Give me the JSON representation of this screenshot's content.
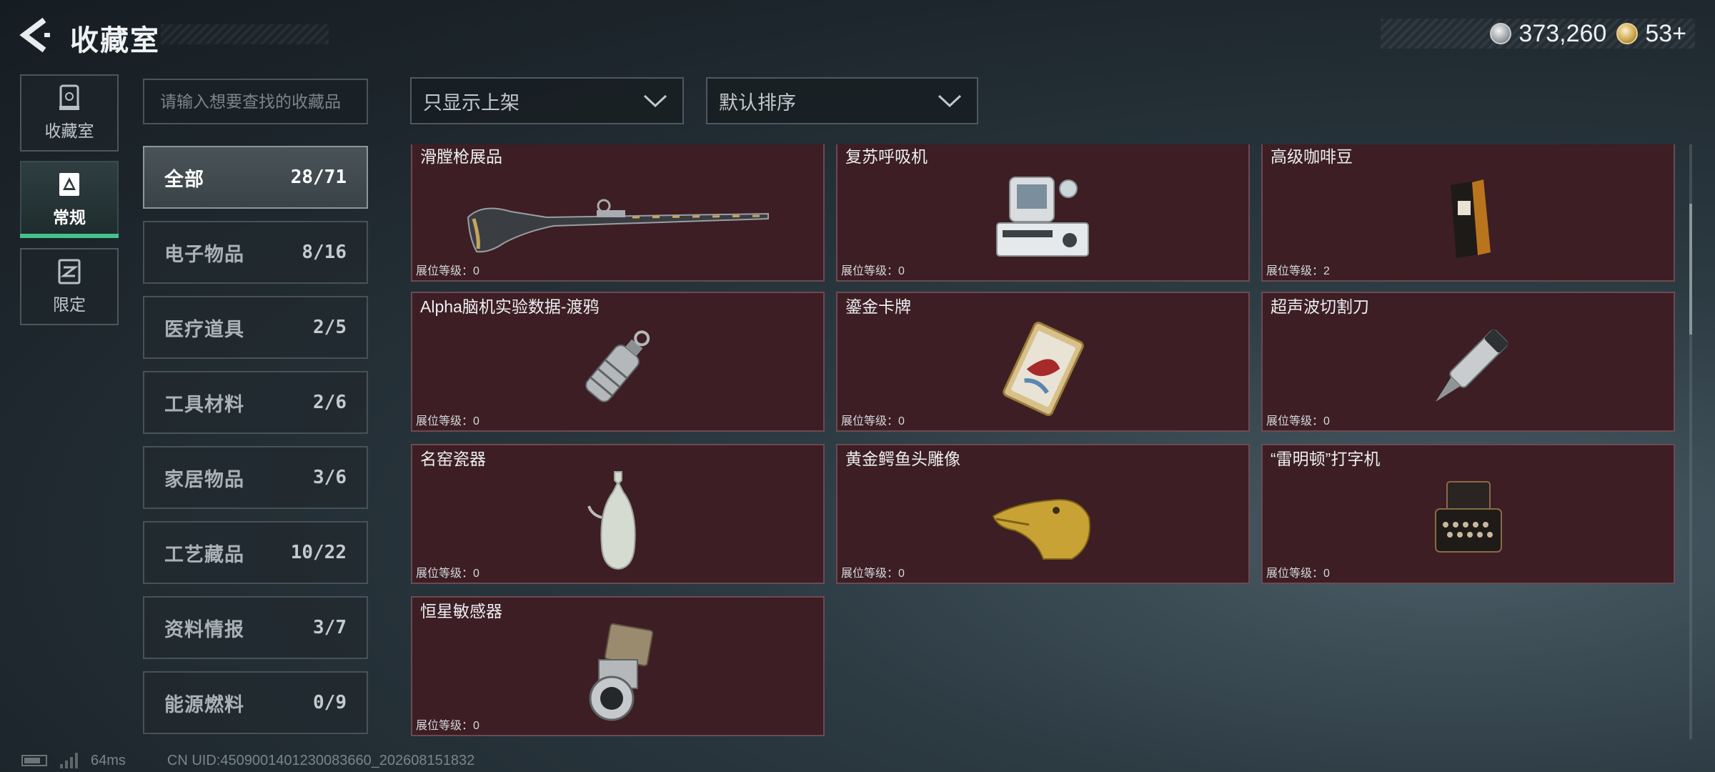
{
  "header": {
    "title": "收藏室",
    "currencies": [
      {
        "icon": "silver-coin-icon",
        "value": "373,260"
      },
      {
        "icon": "gold-coin-icon",
        "value": "53+"
      }
    ]
  },
  "rail": [
    {
      "label": "收藏室",
      "icon": "collection-room-icon",
      "active": false
    },
    {
      "label": "常规",
      "icon": "regular-icon",
      "active": true
    },
    {
      "label": "限定",
      "icon": "limited-icon",
      "active": false
    }
  ],
  "search": {
    "placeholder": "请输入想要查找的收藏品"
  },
  "filters": {
    "display": "只显示上架",
    "sort": "默认排序"
  },
  "categories": [
    {
      "name": "全部",
      "count": "28/71",
      "active": true
    },
    {
      "name": "电子物品",
      "count": "8/16"
    },
    {
      "name": "医疗道具",
      "count": "2/5"
    },
    {
      "name": "工具材料",
      "count": "2/6"
    },
    {
      "name": "家居物品",
      "count": "3/6"
    },
    {
      "name": "工艺藏品",
      "count": "10/22"
    },
    {
      "name": "资料情报",
      "count": "3/7"
    },
    {
      "name": "能源燃料",
      "count": "0/9"
    }
  ],
  "items": [
    {
      "name": "滑膛枪展品",
      "level": "展位等级：0",
      "icon": "musket-icon"
    },
    {
      "name": "复苏呼吸机",
      "level": "展位等级：0",
      "icon": "ventilator-icon"
    },
    {
      "name": "高级咖啡豆",
      "level": "展位等级：2",
      "icon": "coffee-bag-icon"
    },
    {
      "name": "Alpha脑机实验数据-渡鸦",
      "level": "展位等级：0",
      "icon": "data-canister-icon"
    },
    {
      "name": "鎏金卡牌",
      "level": "展位等级：0",
      "icon": "gilded-card-icon"
    },
    {
      "name": "超声波切割刀",
      "level": "展位等级：0",
      "icon": "ultrasonic-knife-icon"
    },
    {
      "name": "名窑瓷器",
      "level": "展位等级：0",
      "icon": "porcelain-vase-icon"
    },
    {
      "name": "黄金鳄鱼头雕像",
      "level": "展位等级：0",
      "icon": "crocodile-statue-icon"
    },
    {
      "name": "“雷明顿”打字机",
      "level": "展位等级：0",
      "icon": "typewriter-icon"
    },
    {
      "name": "恒星敏感器",
      "level": "展位等级：0",
      "icon": "star-sensor-icon"
    }
  ],
  "scroll": {
    "position_fraction": 0.1,
    "visible_fraction": 0.22
  },
  "footer": {
    "latency": "64ms",
    "uid": "CN UID:4509001401230083660_202608151832"
  },
  "colors": {
    "accent": "#45c28a",
    "card_bg": "#3c1e24",
    "card_border": "#6d4a50"
  }
}
